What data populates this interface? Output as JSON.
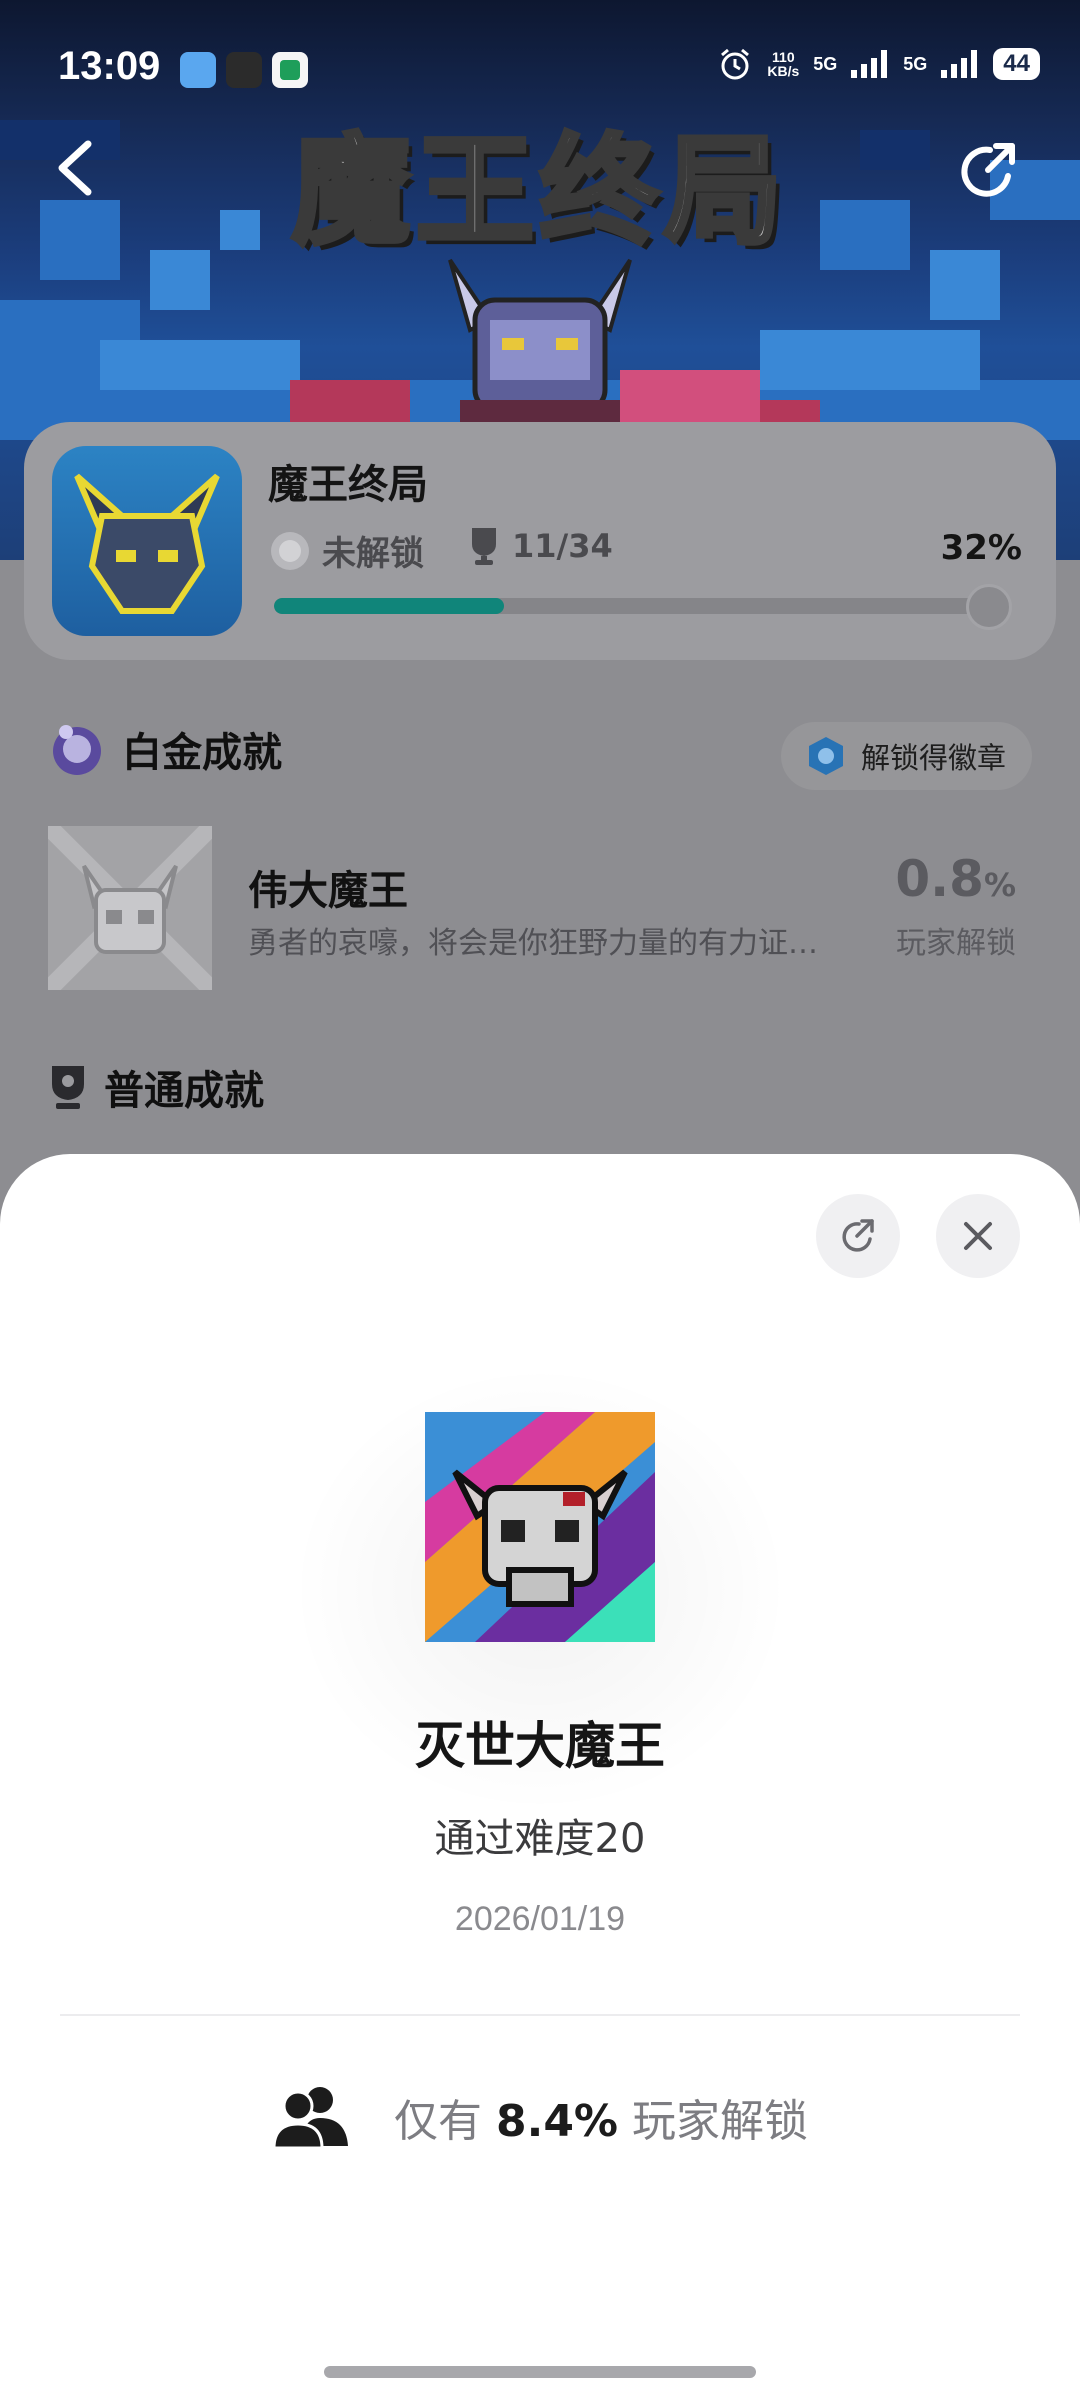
{
  "status_bar": {
    "time": "13:09",
    "netspeed_top": "110",
    "netspeed_bottom": "KB/s",
    "signal1": "5G",
    "signal2": "5G",
    "battery": "44"
  },
  "hero": {
    "logo_text": "魔王终局",
    "back_icon": "chevron-left-icon",
    "share_icon": "share-icon"
  },
  "game": {
    "title": "魔王终局",
    "lock_state": "未解锁",
    "trophy_count": "11/34",
    "progress_label": "32%",
    "progress": 0.32
  },
  "platinum": {
    "heading": "白金成就",
    "badge_button": "解锁得徽章",
    "achievement": {
      "title": "伟大魔王",
      "description": "勇者的哀嚎，将会是你狂野力量的有力证…",
      "rate_value": "0.8",
      "rate_unit": "%",
      "rate_label": "玩家解锁"
    }
  },
  "normal": {
    "heading": "普通成就"
  },
  "sheet": {
    "title": "灭世大魔王",
    "description": "通过难度20",
    "date": "2026/01/19",
    "stat_prefix": "仅有",
    "stat_value": "8.4%",
    "stat_suffix": "玩家解锁",
    "share_icon": "share-icon",
    "close_icon": "close-icon"
  },
  "colors": {
    "progress_fill": "#10857a",
    "sheet_bg": "#ffffff",
    "dim_overlay": "#8d8d91"
  }
}
